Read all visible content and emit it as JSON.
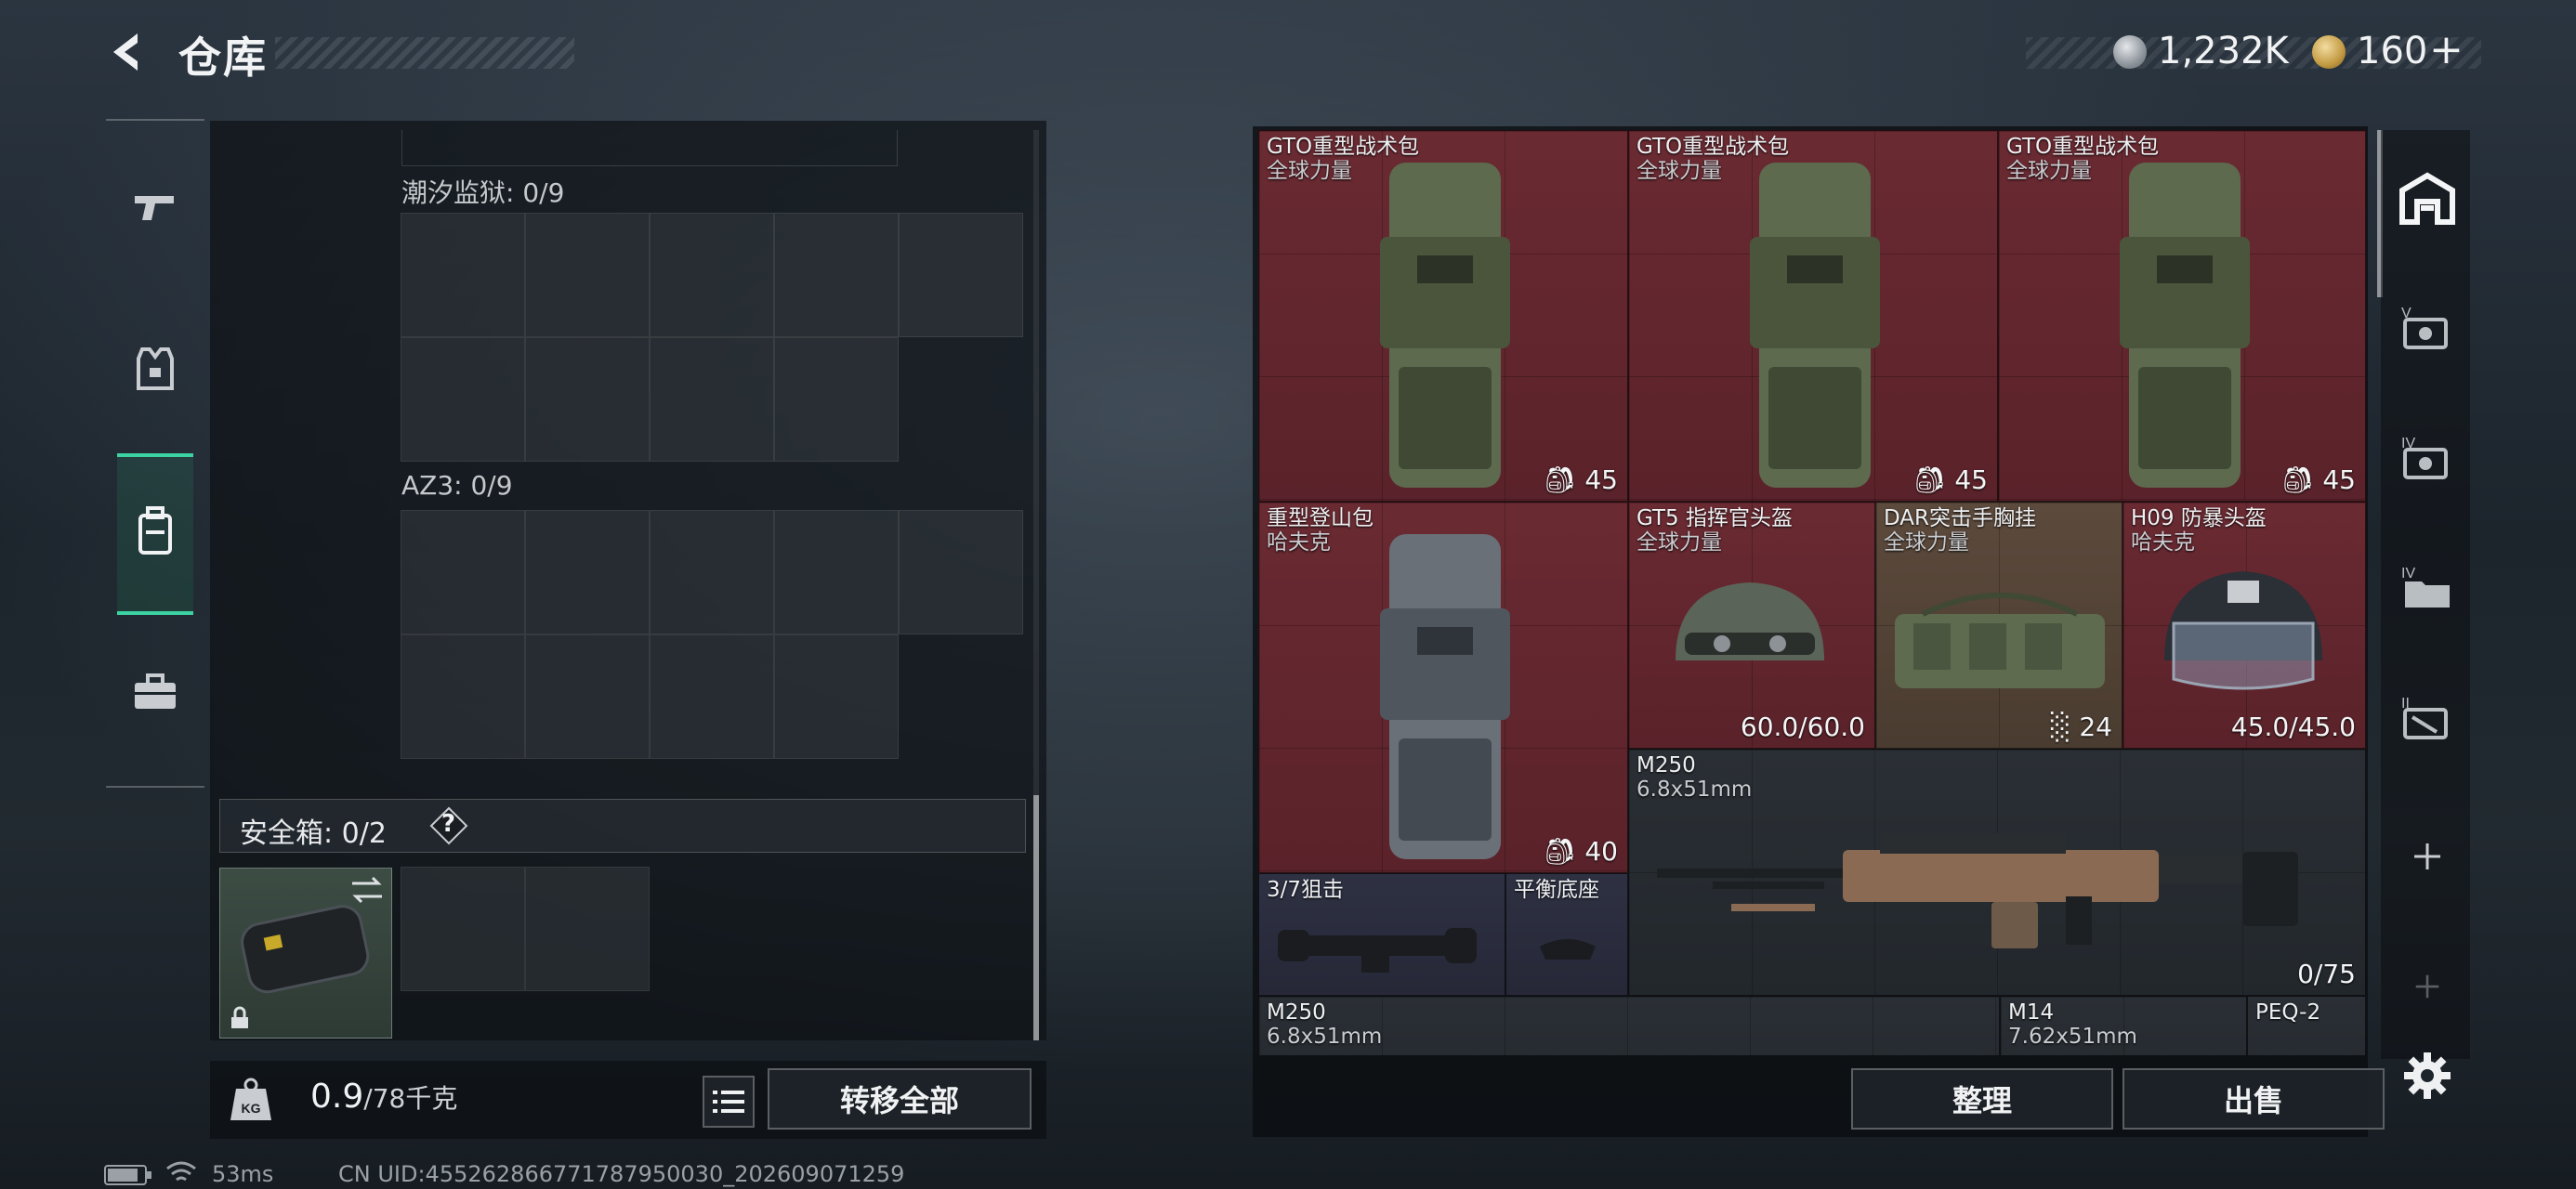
{
  "header": {
    "title": "仓库",
    "currency_silver": "1,232K",
    "currency_gold": "160",
    "add_label": "+"
  },
  "left_nav": {
    "items": [
      {
        "icon": "pistol-icon"
      },
      {
        "icon": "armor-vest-icon"
      },
      {
        "icon": "backpack-icon",
        "active": true
      },
      {
        "icon": "briefcase-icon"
      }
    ]
  },
  "storage": {
    "sections": [
      {
        "label": "潮汐监狱: 0/9"
      },
      {
        "label": "AZ3: 0/9"
      }
    ],
    "safe_box_label": "安全箱: 0/2",
    "help_label": "?",
    "weight_value": "0.9",
    "weight_max": "/78千克",
    "transfer_all_label": "转移全部"
  },
  "inventory": {
    "items": [
      {
        "name": "GTO重型战术包",
        "sub": "全球力量",
        "value": "45",
        "icon": "heavy-backpack-icon",
        "bg": "red"
      },
      {
        "name": "GTO重型战术包",
        "sub": "全球力量",
        "value": "45",
        "icon": "heavy-backpack-icon",
        "bg": "red"
      },
      {
        "name": "GTO重型战术包",
        "sub": "全球力量",
        "value": "45",
        "icon": "heavy-backpack-icon",
        "bg": "red"
      },
      {
        "name": "重型登山包",
        "sub": "哈夫克",
        "value": "40",
        "icon": "mountain-backpack-icon",
        "bg": "red"
      },
      {
        "name": "GT5 指挥官头盔",
        "sub": "全球力量",
        "value": "60.0/60.0",
        "icon": "helmet-icon",
        "bg": "red"
      },
      {
        "name": "DAR突击手胸挂",
        "sub": "全球力量",
        "value": "24",
        "icon": "chest-rig-icon",
        "bg": "brown"
      },
      {
        "name": "H09 防暴头盔",
        "sub": "哈夫克",
        "value": "45.0/45.0",
        "icon": "riot-helmet-icon",
        "bg": "red"
      },
      {
        "name": "M250",
        "sub": "6.8x51mm",
        "value": "0/75",
        "icon": "machine-gun-icon",
        "bg": "dark"
      },
      {
        "name": "3/7狙击",
        "sub": "",
        "value": "",
        "icon": "scope-icon",
        "bg": "navy"
      },
      {
        "name": "平衡底座",
        "sub": "",
        "value": "",
        "icon": "grip-icon",
        "bg": "navy"
      },
      {
        "name": "M250",
        "sub": "6.8x51mm",
        "value": "",
        "icon": "machine-gun-icon",
        "bg": "dark"
      },
      {
        "name": "M14",
        "sub": "7.62x51mm",
        "value": "",
        "icon": "rifle-icon",
        "bg": "dark"
      },
      {
        "name": "PEQ-2",
        "sub": "",
        "value": "",
        "icon": "laser-icon",
        "bg": "dark"
      }
    ],
    "sort_label": "整理",
    "sell_label": "出售"
  },
  "right_toolbar": {
    "items": [
      {
        "icon": "warehouse-icon"
      },
      {
        "icon": "tier-v-case-icon"
      },
      {
        "icon": "tier-iv-case-icon"
      },
      {
        "icon": "tier-iv-folder-icon"
      },
      {
        "icon": "tier-ii-case-icon"
      },
      {
        "icon": "add-icon"
      },
      {
        "icon": "add-icon"
      },
      {
        "icon": "settings-icon"
      }
    ]
  },
  "status_bar": {
    "ping": "53ms",
    "uid": "CN UID:455262866771787950030_202609071259"
  }
}
